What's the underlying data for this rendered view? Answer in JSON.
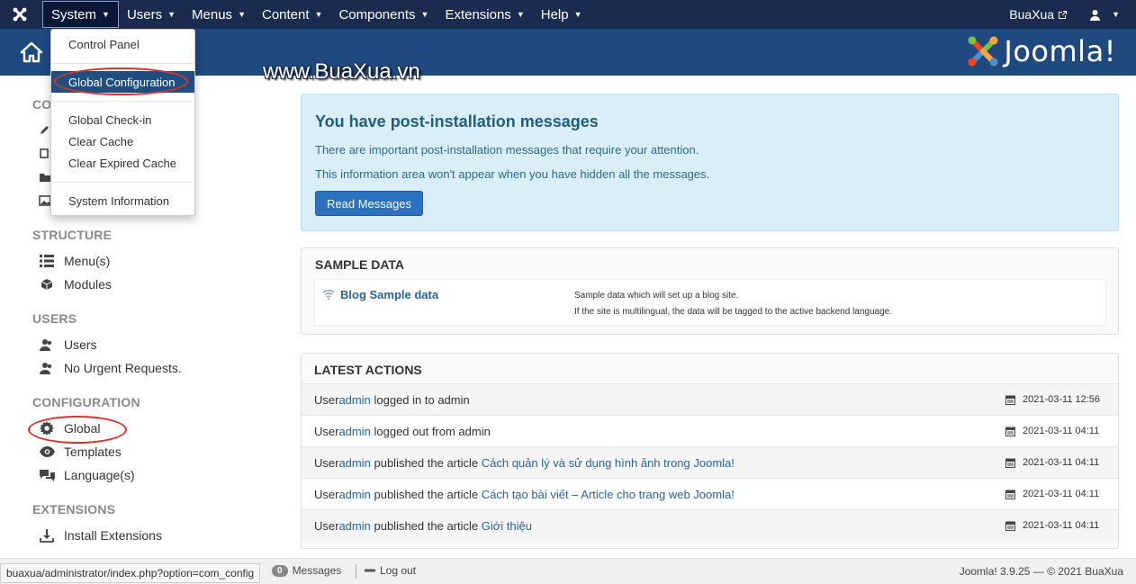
{
  "navbar": {
    "menus": [
      {
        "label": "System"
      },
      {
        "label": "Users"
      },
      {
        "label": "Menus"
      },
      {
        "label": "Content"
      },
      {
        "label": "Components"
      },
      {
        "label": "Extensions"
      },
      {
        "label": "Help"
      }
    ],
    "site_name": "BuaXua",
    "brand_color": "#1b2b4f",
    "header_color": "#1e4a7f"
  },
  "header": {
    "brand": "Joomla!",
    "watermark": "www.BuaXua.vn"
  },
  "system_menu": {
    "items": [
      "Control Panel",
      "Global Configuration",
      "Global Check-in",
      "Clear Cache",
      "Clear Expired Cache",
      "System Information"
    ],
    "selected": "Global Configuration"
  },
  "sidebar": {
    "partial_heading": "CO",
    "sections": [
      {
        "title": "STRUCTURE",
        "items": [
          "Menu(s)",
          "Modules"
        ]
      },
      {
        "title": "USERS",
        "items": [
          "Users",
          "No Urgent Requests."
        ]
      },
      {
        "title": "CONFIGURATION",
        "items": [
          "Global",
          "Templates",
          "Language(s)"
        ]
      },
      {
        "title": "EXTENSIONS",
        "items": [
          "Install Extensions"
        ]
      }
    ]
  },
  "post_install": {
    "title": "You have post-installation messages",
    "line1": "There are important post-installation messages that require your attention.",
    "line2": "This information area won't appear when you have hidden all the messages.",
    "button": "Read Messages"
  },
  "sample_data": {
    "title": "SAMPLE DATA",
    "link": "Blog Sample data",
    "desc1": "Sample data which will set up a blog site.",
    "desc2": "If the site is multilingual, the data will be tagged to the active backend language."
  },
  "latest_actions": {
    "title": "LATEST ACTIONS",
    "rows": [
      {
        "pre": "User ",
        "user": "admin",
        "mid": " logged in to admin",
        "article": "",
        "date": "2021-03-11 12:56"
      },
      {
        "pre": "User ",
        "user": "admin",
        "mid": " logged out from admin",
        "article": "",
        "date": "2021-03-11 04:11"
      },
      {
        "pre": "User ",
        "user": "admin",
        "mid": " published the article ",
        "article": "Cách quản lý và sử dụng hình ảnh trong Joomla!",
        "date": "2021-03-11 04:11"
      },
      {
        "pre": "User ",
        "user": "admin",
        "mid": " published the article ",
        "article": "Cách tạo bài viết – Article cho trang web Joomla!",
        "date": "2021-03-11 04:11"
      },
      {
        "pre": "User ",
        "user": "admin",
        "mid": " published the article ",
        "article": "Giới thiệu",
        "date": "2021-03-11 04:11"
      }
    ]
  },
  "footer": {
    "url": "buaxua/administrator/index.php?option=com_config",
    "messages_count": "0",
    "messages_label": "Messages",
    "logout": "Log out",
    "copyright": "Joomla! 3.9.25 — © 2021 BuaXua"
  }
}
